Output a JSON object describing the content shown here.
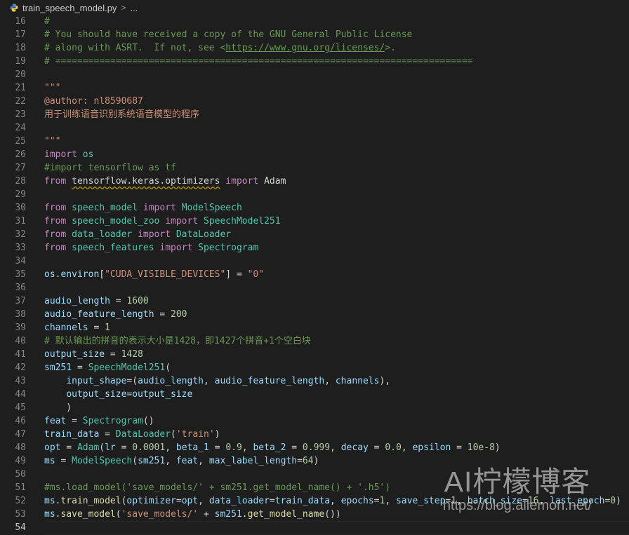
{
  "breadcrumb": {
    "file": "train_speech_model.py",
    "separator": ">",
    "rest": "..."
  },
  "watermark": {
    "title": "AI柠檬博客",
    "url": "https://blog.ailemon.net/"
  },
  "theme": {
    "background": "#1e1e1e",
    "comment": "#6a9955",
    "string": "#ce9178",
    "keyword": "#c586c0",
    "class": "#4ec9b0",
    "number": "#b5cea8"
  },
  "current_line": 54,
  "lines": [
    {
      "n": "16",
      "t": [
        [
          "c",
          "#"
        ]
      ]
    },
    {
      "n": "17",
      "t": [
        [
          "c",
          "# You should have received a copy of the GNU General Public License"
        ]
      ]
    },
    {
      "n": "18",
      "t": [
        [
          "c",
          "# along with ASRT.  If not, see <"
        ],
        [
          "l",
          "https://www.gnu.org/licenses/"
        ],
        [
          "c",
          ">."
        ]
      ]
    },
    {
      "n": "19",
      "t": [
        [
          "c",
          "# ============================================================================"
        ]
      ]
    },
    {
      "n": "20",
      "t": []
    },
    {
      "n": "21",
      "t": [
        [
          "s",
          "\"\"\""
        ]
      ]
    },
    {
      "n": "22",
      "t": [
        [
          "s",
          "@author: nl8590687"
        ]
      ]
    },
    {
      "n": "23",
      "t": [
        [
          "s",
          "用于训练语音识别系统语音模型的程序"
        ]
      ]
    },
    {
      "n": "24",
      "t": []
    },
    {
      "n": "25",
      "t": [
        [
          "s",
          "\"\"\""
        ]
      ]
    },
    {
      "n": "26",
      "t": [
        [
          "k",
          "import"
        ],
        [
          "p",
          " "
        ],
        [
          "g",
          "os"
        ]
      ]
    },
    {
      "n": "27",
      "t": [
        [
          "c",
          "#import tensorflow as tf"
        ]
      ]
    },
    {
      "n": "28",
      "t": [
        [
          "k",
          "from"
        ],
        [
          "p",
          " "
        ],
        [
          "w",
          "tensorflow.keras.optimizers"
        ],
        [
          "p",
          " "
        ],
        [
          "k",
          "import"
        ],
        [
          "p",
          " "
        ],
        [
          "p",
          "Adam"
        ]
      ]
    },
    {
      "n": "29",
      "t": []
    },
    {
      "n": "30",
      "t": [
        [
          "k",
          "from"
        ],
        [
          "p",
          " "
        ],
        [
          "g",
          "speech_model"
        ],
        [
          "p",
          " "
        ],
        [
          "k",
          "import"
        ],
        [
          "p",
          " "
        ],
        [
          "y",
          "ModelSpeech"
        ]
      ]
    },
    {
      "n": "31",
      "t": [
        [
          "k",
          "from"
        ],
        [
          "p",
          " "
        ],
        [
          "g",
          "speech_model_zoo"
        ],
        [
          "p",
          " "
        ],
        [
          "k",
          "import"
        ],
        [
          "p",
          " "
        ],
        [
          "y",
          "SpeechModel251"
        ]
      ]
    },
    {
      "n": "32",
      "t": [
        [
          "k",
          "from"
        ],
        [
          "p",
          " "
        ],
        [
          "g",
          "data_loader"
        ],
        [
          "p",
          " "
        ],
        [
          "k",
          "import"
        ],
        [
          "p",
          " "
        ],
        [
          "y",
          "DataLoader"
        ]
      ]
    },
    {
      "n": "33",
      "t": [
        [
          "k",
          "from"
        ],
        [
          "p",
          " "
        ],
        [
          "g",
          "speech_features"
        ],
        [
          "p",
          " "
        ],
        [
          "k",
          "import"
        ],
        [
          "p",
          " "
        ],
        [
          "y",
          "Spectrogram"
        ]
      ]
    },
    {
      "n": "34",
      "t": []
    },
    {
      "n": "35",
      "t": [
        [
          "v",
          "os"
        ],
        [
          "p",
          "."
        ],
        [
          "v",
          "environ"
        ],
        [
          "p",
          "["
        ],
        [
          "s",
          "\"CUDA_VISIBLE_DEVICES\""
        ],
        [
          "p",
          "] = "
        ],
        [
          "s",
          "\"0\""
        ]
      ]
    },
    {
      "n": "36",
      "t": []
    },
    {
      "n": "37",
      "t": [
        [
          "v",
          "audio_length"
        ],
        [
          "p",
          " = "
        ],
        [
          "nu",
          "1600"
        ]
      ]
    },
    {
      "n": "38",
      "t": [
        [
          "v",
          "audio_feature_length"
        ],
        [
          "p",
          " = "
        ],
        [
          "nu",
          "200"
        ]
      ]
    },
    {
      "n": "39",
      "t": [
        [
          "v",
          "channels"
        ],
        [
          "p",
          " = "
        ],
        [
          "nu",
          "1"
        ]
      ]
    },
    {
      "n": "40",
      "t": [
        [
          "c",
          "# 默认输出的拼音的表示大小是1428，即1427个拼音+1个空白块"
        ]
      ]
    },
    {
      "n": "41",
      "t": [
        [
          "v",
          "output_size"
        ],
        [
          "p",
          " = "
        ],
        [
          "nu",
          "1428"
        ]
      ]
    },
    {
      "n": "42",
      "t": [
        [
          "v",
          "sm251"
        ],
        [
          "p",
          " = "
        ],
        [
          "y",
          "SpeechModel251"
        ],
        [
          "p",
          "("
        ]
      ]
    },
    {
      "n": "43",
      "t": [
        [
          "p",
          "    "
        ],
        [
          "v",
          "input_shape"
        ],
        [
          "p",
          "=("
        ],
        [
          "v",
          "audio_length"
        ],
        [
          "p",
          ", "
        ],
        [
          "v",
          "audio_feature_length"
        ],
        [
          "p",
          ", "
        ],
        [
          "v",
          "channels"
        ],
        [
          "p",
          "),"
        ]
      ]
    },
    {
      "n": "44",
      "t": [
        [
          "p",
          "    "
        ],
        [
          "v",
          "output_size"
        ],
        [
          "p",
          "="
        ],
        [
          "v",
          "output_size"
        ]
      ]
    },
    {
      "n": "45",
      "t": [
        [
          "p",
          "    )"
        ]
      ]
    },
    {
      "n": "46",
      "t": [
        [
          "v",
          "feat"
        ],
        [
          "p",
          " = "
        ],
        [
          "y",
          "Spectrogram"
        ],
        [
          "p",
          "()"
        ]
      ]
    },
    {
      "n": "47",
      "t": [
        [
          "v",
          "train_data"
        ],
        [
          "p",
          " = "
        ],
        [
          "y",
          "DataLoader"
        ],
        [
          "p",
          "("
        ],
        [
          "s",
          "'train'"
        ],
        [
          "p",
          ")"
        ]
      ]
    },
    {
      "n": "48",
      "t": [
        [
          "v",
          "opt"
        ],
        [
          "p",
          " = "
        ],
        [
          "y",
          "Adam"
        ],
        [
          "p",
          "("
        ],
        [
          "v",
          "lr"
        ],
        [
          "p",
          " = "
        ],
        [
          "nu",
          "0.0001"
        ],
        [
          "p",
          ", "
        ],
        [
          "v",
          "beta_1"
        ],
        [
          "p",
          " = "
        ],
        [
          "nu",
          "0.9"
        ],
        [
          "p",
          ", "
        ],
        [
          "v",
          "beta_2"
        ],
        [
          "p",
          " = "
        ],
        [
          "nu",
          "0.999"
        ],
        [
          "p",
          ", "
        ],
        [
          "v",
          "decay"
        ],
        [
          "p",
          " = "
        ],
        [
          "nu",
          "0.0"
        ],
        [
          "p",
          ", "
        ],
        [
          "v",
          "epsilon"
        ],
        [
          "p",
          " = "
        ],
        [
          "nu",
          "10e-8"
        ],
        [
          "p",
          ")"
        ]
      ]
    },
    {
      "n": "49",
      "t": [
        [
          "v",
          "ms"
        ],
        [
          "p",
          " = "
        ],
        [
          "y",
          "ModelSpeech"
        ],
        [
          "p",
          "("
        ],
        [
          "v",
          "sm251"
        ],
        [
          "p",
          ", "
        ],
        [
          "v",
          "feat"
        ],
        [
          "p",
          ", "
        ],
        [
          "v",
          "max_label_length"
        ],
        [
          "p",
          "="
        ],
        [
          "nu",
          "64"
        ],
        [
          "p",
          ")"
        ]
      ]
    },
    {
      "n": "50",
      "t": []
    },
    {
      "n": "51",
      "t": [
        [
          "c",
          "#ms.load_model('save_models/' + sm251.get_model_name() + '.h5')"
        ]
      ]
    },
    {
      "n": "52",
      "t": [
        [
          "v",
          "ms"
        ],
        [
          "p",
          "."
        ],
        [
          "f",
          "train_model"
        ],
        [
          "p",
          "("
        ],
        [
          "v",
          "optimizer"
        ],
        [
          "p",
          "="
        ],
        [
          "v",
          "opt"
        ],
        [
          "p",
          ", "
        ],
        [
          "v",
          "data_loader"
        ],
        [
          "p",
          "="
        ],
        [
          "v",
          "train_data"
        ],
        [
          "p",
          ", "
        ],
        [
          "v",
          "epochs"
        ],
        [
          "p",
          "="
        ],
        [
          "nu",
          "1"
        ],
        [
          "p",
          ", "
        ],
        [
          "v",
          "save_step"
        ],
        [
          "p",
          "="
        ],
        [
          "nu",
          "1"
        ],
        [
          "p",
          ", "
        ],
        [
          "v",
          "batch_size"
        ],
        [
          "p",
          "="
        ],
        [
          "nu",
          "16"
        ],
        [
          "p",
          ", "
        ],
        [
          "v",
          "last_epoch"
        ],
        [
          "p",
          "="
        ],
        [
          "nu",
          "0"
        ],
        [
          "p",
          ")"
        ]
      ]
    },
    {
      "n": "53",
      "t": [
        [
          "v",
          "ms"
        ],
        [
          "p",
          "."
        ],
        [
          "f",
          "save_model"
        ],
        [
          "p",
          "("
        ],
        [
          "s",
          "'save_models/'"
        ],
        [
          "p",
          " + "
        ],
        [
          "v",
          "sm251"
        ],
        [
          "p",
          "."
        ],
        [
          "f",
          "get_model_name"
        ],
        [
          "p",
          "())"
        ]
      ]
    },
    {
      "n": "54",
      "t": []
    }
  ]
}
